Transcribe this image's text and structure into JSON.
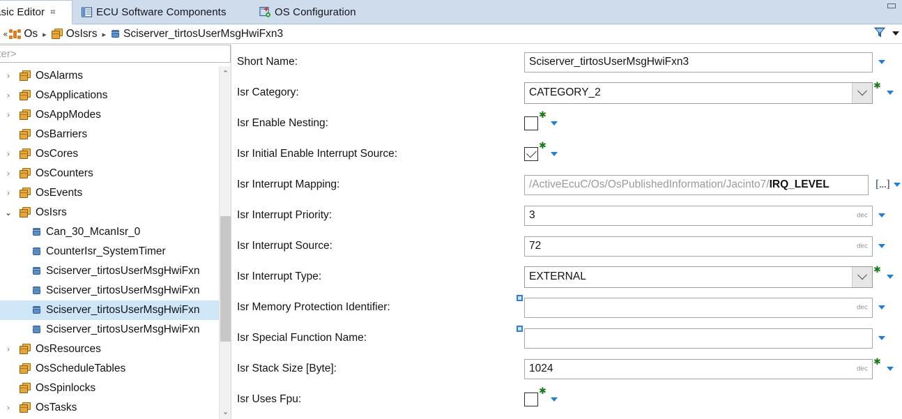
{
  "window": {
    "minimize_label": "minimize"
  },
  "tabs": [
    {
      "label": "asic Editor",
      "icon": "none",
      "active": true,
      "closable": true,
      "close_glyph": "⌗"
    },
    {
      "label": "ECU Software Components",
      "icon": "ecu-components-icon",
      "active": false,
      "closable": false
    },
    {
      "label": "OS Configuration",
      "icon": "os-config-icon",
      "active": false,
      "closable": false
    }
  ],
  "breadcrumb": {
    "collapse_glyph": "«",
    "separator": "▸",
    "items": [
      {
        "label": "Os",
        "icon": "os-node-icon"
      },
      {
        "label": "OsIsrs",
        "icon": "package-icon"
      },
      {
        "label": "Sciserver_tirtosUserMsgHwiFxn3",
        "icon": "element-icon"
      }
    ],
    "filter_icon": "filter-funnel-icon",
    "menu_icon": "chevron-down-icon"
  },
  "tree": {
    "filter_placeholder": "lter>",
    "scroll_up_glyph": "⌃",
    "scroll_down_glyph": "⌄",
    "items": [
      {
        "label": "OsAlarms",
        "icon": "package-icon",
        "twisty": "›",
        "depth": 0,
        "selected": false
      },
      {
        "label": "OsApplications",
        "icon": "package-icon",
        "twisty": "›",
        "depth": 0,
        "selected": false
      },
      {
        "label": "OsAppModes",
        "icon": "package-icon",
        "twisty": "›",
        "depth": 0,
        "selected": false
      },
      {
        "label": "OsBarriers",
        "icon": "package-icon",
        "twisty": "",
        "depth": 0,
        "selected": false
      },
      {
        "label": "OsCores",
        "icon": "package-icon",
        "twisty": "›",
        "depth": 0,
        "selected": false
      },
      {
        "label": "OsCounters",
        "icon": "package-icon",
        "twisty": "›",
        "depth": 0,
        "selected": false
      },
      {
        "label": "OsEvents",
        "icon": "package-icon",
        "twisty": "›",
        "depth": 0,
        "selected": false
      },
      {
        "label": "OsIsrs",
        "icon": "package-icon",
        "twisty": "⌄",
        "depth": 0,
        "selected": false,
        "expanded": true
      },
      {
        "label": "Can_30_McanIsr_0",
        "icon": "element-icon",
        "twisty": "",
        "depth": 1,
        "selected": false
      },
      {
        "label": "CounterIsr_SystemTimer",
        "icon": "element-icon",
        "twisty": "",
        "depth": 1,
        "selected": false
      },
      {
        "label": "Sciserver_tirtosUserMsgHwiFxn",
        "icon": "element-icon",
        "twisty": "",
        "depth": 1,
        "selected": false
      },
      {
        "label": "Sciserver_tirtosUserMsgHwiFxn",
        "icon": "element-icon",
        "twisty": "",
        "depth": 1,
        "selected": false
      },
      {
        "label": "Sciserver_tirtosUserMsgHwiFxn",
        "icon": "element-icon",
        "twisty": "",
        "depth": 1,
        "selected": true
      },
      {
        "label": "Sciserver_tirtosUserMsgHwiFxn",
        "icon": "element-icon",
        "twisty": "",
        "depth": 1,
        "selected": false
      },
      {
        "label": "OsResources",
        "icon": "package-icon",
        "twisty": "›",
        "depth": 0,
        "selected": false
      },
      {
        "label": "OsScheduleTables",
        "icon": "package-icon",
        "twisty": "",
        "depth": 0,
        "selected": false
      },
      {
        "label": "OsSpinlocks",
        "icon": "package-icon",
        "twisty": "",
        "depth": 0,
        "selected": false
      },
      {
        "label": "OsTasks",
        "icon": "package-icon",
        "twisty": "›",
        "depth": 0,
        "selected": false
      }
    ]
  },
  "form": {
    "rows": [
      {
        "label": "Short Name:",
        "type": "text",
        "value": "Sciserver_tirtosUserMsgHwiFxn3",
        "unit": "",
        "required": false,
        "caret": true
      },
      {
        "label": "Isr Category:",
        "type": "combo",
        "value": "CATEGORY_2",
        "required": true,
        "caret": true
      },
      {
        "label": "Isr Enable Nesting:",
        "type": "checkbox",
        "checked": false,
        "required": true,
        "caret": true
      },
      {
        "label": "Isr Initial Enable Interrupt Source:",
        "type": "checkbox",
        "checked": true,
        "required": true,
        "caret": true
      },
      {
        "label": "Isr Interrupt Mapping:",
        "type": "reference",
        "value_gray": "/ActiveEcuC/Os/OsPublishedInformation/Jacinto7/",
        "value_black": "IRQ_LEVEL",
        "browse_label": "[...]",
        "required": false,
        "caret": true
      },
      {
        "label": "Isr Interrupt Priority:",
        "type": "text",
        "value": "3",
        "unit": "dec",
        "required": false,
        "caret": true
      },
      {
        "label": "Isr Interrupt Source:",
        "type": "text",
        "value": "72",
        "unit": "dec",
        "required": false,
        "caret": true
      },
      {
        "label": "Isr Interrupt Type:",
        "type": "combo",
        "value": "EXTERNAL",
        "required": true,
        "caret": true
      },
      {
        "label": "Isr Memory Protection Identifier:",
        "type": "text",
        "value": "",
        "unit": "dec",
        "required": false,
        "marker": true,
        "caret": true
      },
      {
        "label": "Isr Special Function Name:",
        "type": "text",
        "value": "",
        "unit": "",
        "required": false,
        "marker": true,
        "caret": true
      },
      {
        "label": "Isr Stack Size [Byte]:",
        "type": "text",
        "value": "1024",
        "unit": "dec",
        "required": true,
        "caret": true
      },
      {
        "label": "Isr Uses Fpu:",
        "type": "checkbox",
        "checked": false,
        "required": true,
        "caret": true
      }
    ]
  },
  "colors": {
    "tab_bar": "#cfdcec",
    "selection": "#cfe6f7",
    "accent_caret": "#1f7fd4",
    "required_asterisk": "#1a7a1a",
    "package_icon": "#e8a63a",
    "element_icon": "#5b8fc9"
  }
}
